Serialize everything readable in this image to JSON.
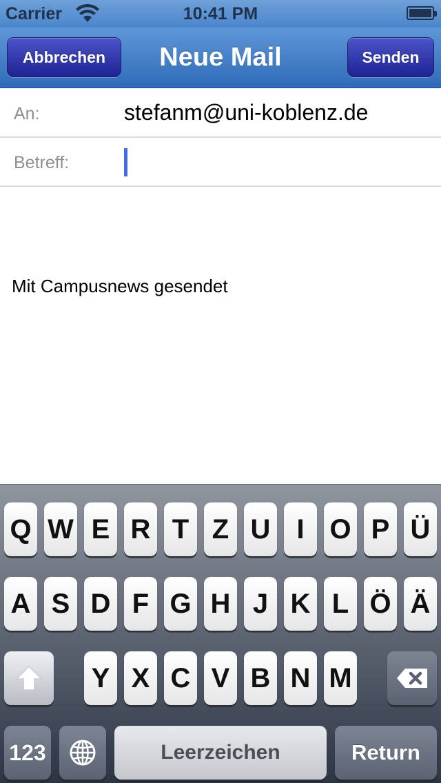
{
  "status_bar": {
    "carrier": "Carrier",
    "time": "10:41 PM",
    "wifi_icon": "wifi-icon",
    "battery_icon": "battery-icon"
  },
  "nav": {
    "title": "Neue Mail",
    "cancel_label": "Abbrechen",
    "send_label": "Senden"
  },
  "compose": {
    "to_label": "An:",
    "to_value": "stefanm@uni-koblenz.de",
    "subject_label": "Betreff:",
    "subject_value": "",
    "body": "Mit Campusnews gesendet"
  },
  "keyboard": {
    "row1": [
      "Q",
      "W",
      "E",
      "R",
      "T",
      "Z",
      "U",
      "I",
      "O",
      "P",
      "Ü"
    ],
    "row2": [
      "A",
      "S",
      "D",
      "F",
      "G",
      "H",
      "J",
      "K",
      "L",
      "Ö",
      "Ä"
    ],
    "row3": [
      "Y",
      "X",
      "C",
      "V",
      "B",
      "N",
      "M"
    ],
    "numbers_label": "123",
    "space_label": "Leerzeichen",
    "return_label": "Return",
    "shift_icon": "shift-icon",
    "globe_icon": "globe-icon",
    "delete_icon": "delete-icon"
  },
  "colors": {
    "nav_blue": "#2f6bb8",
    "button_navy": "#1e2493",
    "cursor_blue": "#3f6de6"
  }
}
